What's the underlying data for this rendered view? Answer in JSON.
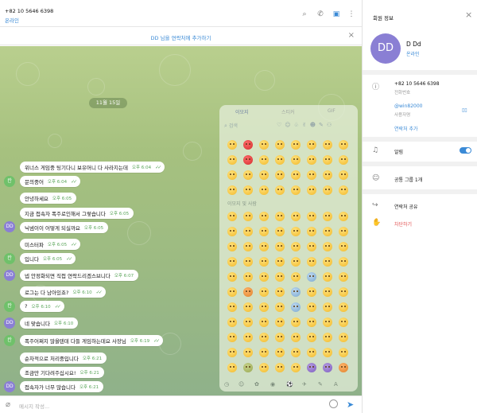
{
  "header": {
    "name": "+82 10 5646 6398",
    "status": "온라인"
  },
  "banner": {
    "text": "DD 님을 연락처에 추가하기"
  },
  "date_chip": "11월 15일",
  "messages": [
    {
      "text": "위너스 게임중 팅기다니 보유머니 다 사라지는데",
      "time": "오후 6:04",
      "checks": "✓✓"
    },
    {
      "text": "문의중어",
      "time": "오후 6:04",
      "checks": "✓✓"
    },
    {
      "text": "안녕하세요",
      "time": "오후 6:05",
      "checks": ""
    },
    {
      "text": "지금 접속자 폭주로인해서 그렇습니다",
      "time": "오후 6:05",
      "checks": ""
    },
    {
      "text": "닉넴이이 어떻게 되실까요",
      "time": "오후 6:05",
      "checks": ""
    },
    {
      "text": "미스터파",
      "time": "오후 6:05",
      "checks": "✓✓"
    },
    {
      "text": "입니다",
      "time": "오후 6:05",
      "checks": "✓✓"
    },
    {
      "text": "넵 안정화되면 직접 연락드리겠스브니다",
      "time": "오후 6:07",
      "checks": ""
    },
    {
      "text": "로그는 다 남아있죠?",
      "time": "오후 6:10",
      "checks": "✓✓"
    },
    {
      "text": "?",
      "time": "오후 6:10",
      "checks": "✓✓"
    },
    {
      "text": "네 맞습니다",
      "time": "오후 6:10",
      "checks": ""
    },
    {
      "text": "폭주어쩌지 많을텐데 다들 게임하는데요 사장님",
      "time": "오후 6:19",
      "checks": "✓✓"
    },
    {
      "text": "순차적으로 처리중입니다",
      "time": "오후 6:21",
      "checks": ""
    },
    {
      "text": "조금만 기다려주십시요!",
      "time": "오후 6:21",
      "checks": ""
    },
    {
      "text": "접속자가 너무 많습니다",
      "time": "오후 6:21",
      "checks": ""
    }
  ],
  "avatars": {
    "me": "칸",
    "them": "DD"
  },
  "emoji_panel": {
    "tabs": [
      "이모지",
      "스티커",
      "GIF"
    ],
    "search_placeholder": "검색",
    "recent_section": "이모지 및 사람"
  },
  "input": {
    "placeholder": "메시지 작성..."
  },
  "profile": {
    "panel_title": "회원 정보",
    "initials": "DD",
    "name": "D Dd",
    "status": "온라인",
    "phone": "+82 10 5646 6398",
    "phone_label": "전화번호",
    "username": "@win82000",
    "username_label": "사용자명",
    "add_contact": "연락처 추가",
    "notifications": "알림",
    "common_groups": "공통 그룹 1개",
    "share_contact": "연락처 공유",
    "block": "차단하기",
    "qr_glyph": "▯▯"
  },
  "colors": {
    "accent": "#3a8ad6",
    "danger": "#e14d4d",
    "bubble_meta": "#5aa55a"
  }
}
